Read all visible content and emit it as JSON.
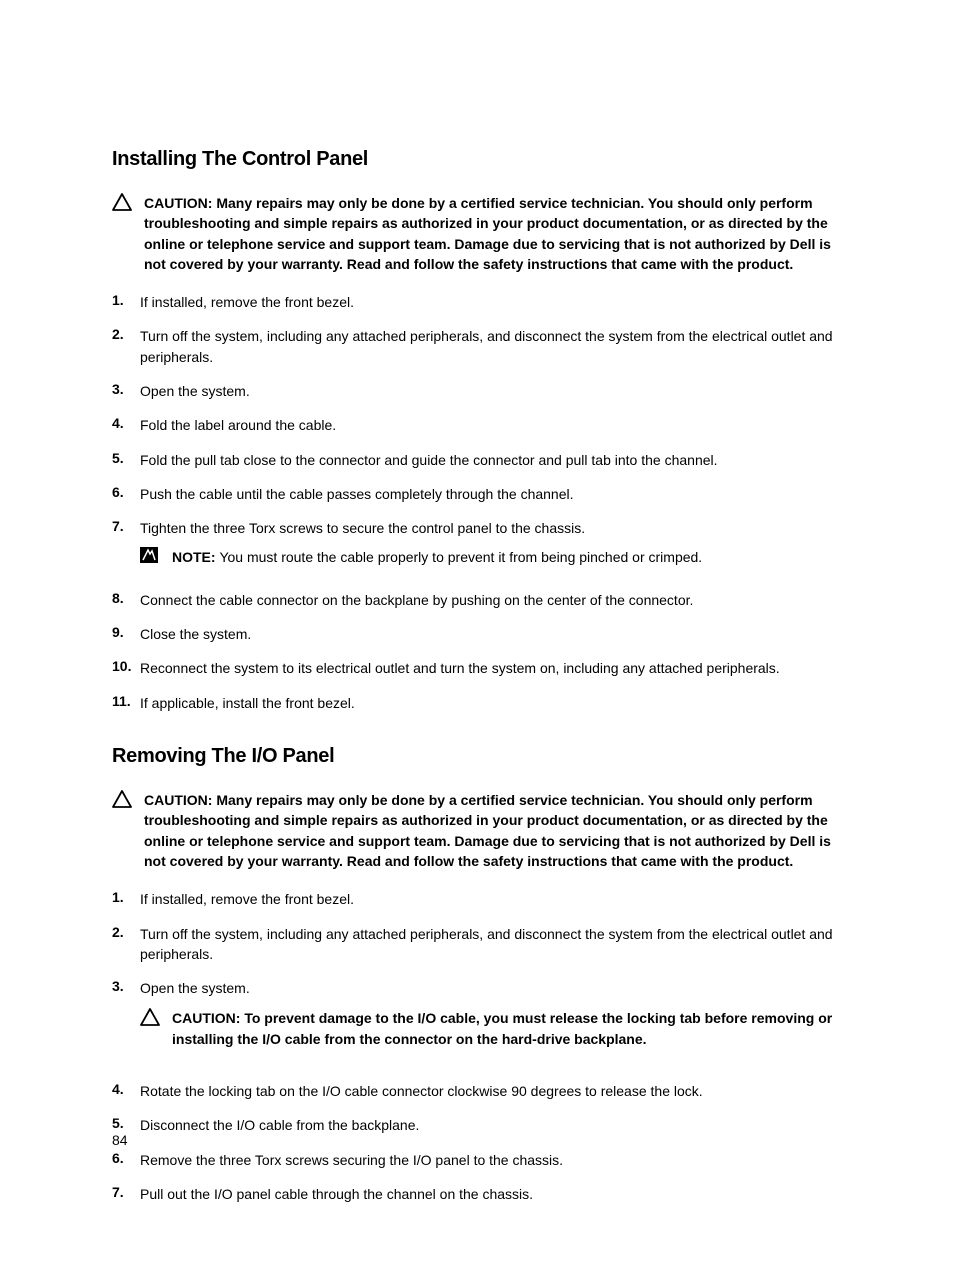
{
  "section1": {
    "heading": "Installing The Control Panel",
    "caution": "CAUTION: Many repairs may only be done by a certified service technician. You should only perform troubleshooting and simple repairs as authorized in your product documentation, or as directed by the online or telephone service and support team. Damage due to servicing that is not authorized by Dell is not covered by your warranty. Read and follow the safety instructions that came with the product.",
    "steps": {
      "s1": {
        "num": "1.",
        "text": "If installed, remove the front bezel."
      },
      "s2": {
        "num": "2.",
        "text": "Turn off the system, including any attached peripherals, and disconnect the system from the electrical outlet and peripherals."
      },
      "s3": {
        "num": "3.",
        "text": "Open the system."
      },
      "s4": {
        "num": "4.",
        "text": "Fold the label around the cable."
      },
      "s5": {
        "num": "5.",
        "text": "Fold the pull tab close to the connector and guide the connector and pull tab into the channel."
      },
      "s6": {
        "num": "6.",
        "text": "Push the cable until the cable passes completely through the channel."
      },
      "s7": {
        "num": "7.",
        "text": "Tighten the three Torx screws to secure the control panel to the chassis."
      },
      "s7note_label": "NOTE: ",
      "s7note_text": "You must route the cable properly to prevent it from being pinched or crimped.",
      "s8": {
        "num": "8.",
        "text": "Connect the cable connector on the backplane by pushing on the center of the connector."
      },
      "s9": {
        "num": "9.",
        "text": "Close the system."
      },
      "s10": {
        "num": "10.",
        "text": "Reconnect the system to its electrical outlet and turn the system on, including any attached peripherals."
      },
      "s11": {
        "num": "11.",
        "text": "If applicable, install the front bezel."
      }
    }
  },
  "section2": {
    "heading": "Removing The I/O Panel",
    "caution": "CAUTION: Many repairs may only be done by a certified service technician. You should only perform troubleshooting and simple repairs as authorized in your product documentation, or as directed by the online or telephone service and support team. Damage due to servicing that is not authorized by Dell is not covered by your warranty. Read and follow the safety instructions that came with the product.",
    "steps": {
      "s1": {
        "num": "1.",
        "text": "If installed, remove the front bezel."
      },
      "s2": {
        "num": "2.",
        "text": "Turn off the system, including any attached peripherals, and disconnect the system from the electrical outlet and peripherals."
      },
      "s3": {
        "num": "3.",
        "text": "Open the system."
      },
      "s3caution": "CAUTION: To prevent damage to the I/O cable, you must release the locking tab before removing or installing the I/O cable from the connector on the hard-drive backplane.",
      "s4": {
        "num": "4.",
        "text": "Rotate the locking tab on the I/O cable connector clockwise 90 degrees to release the lock."
      },
      "s5": {
        "num": "5.",
        "text": "Disconnect the I/O cable from the backplane."
      },
      "s6": {
        "num": "6.",
        "text": "Remove the three Torx screws securing the I/O panel to the chassis."
      },
      "s7": {
        "num": "7.",
        "text": "Pull out the I/O panel cable through the channel on the chassis."
      }
    }
  },
  "page_number": "84"
}
